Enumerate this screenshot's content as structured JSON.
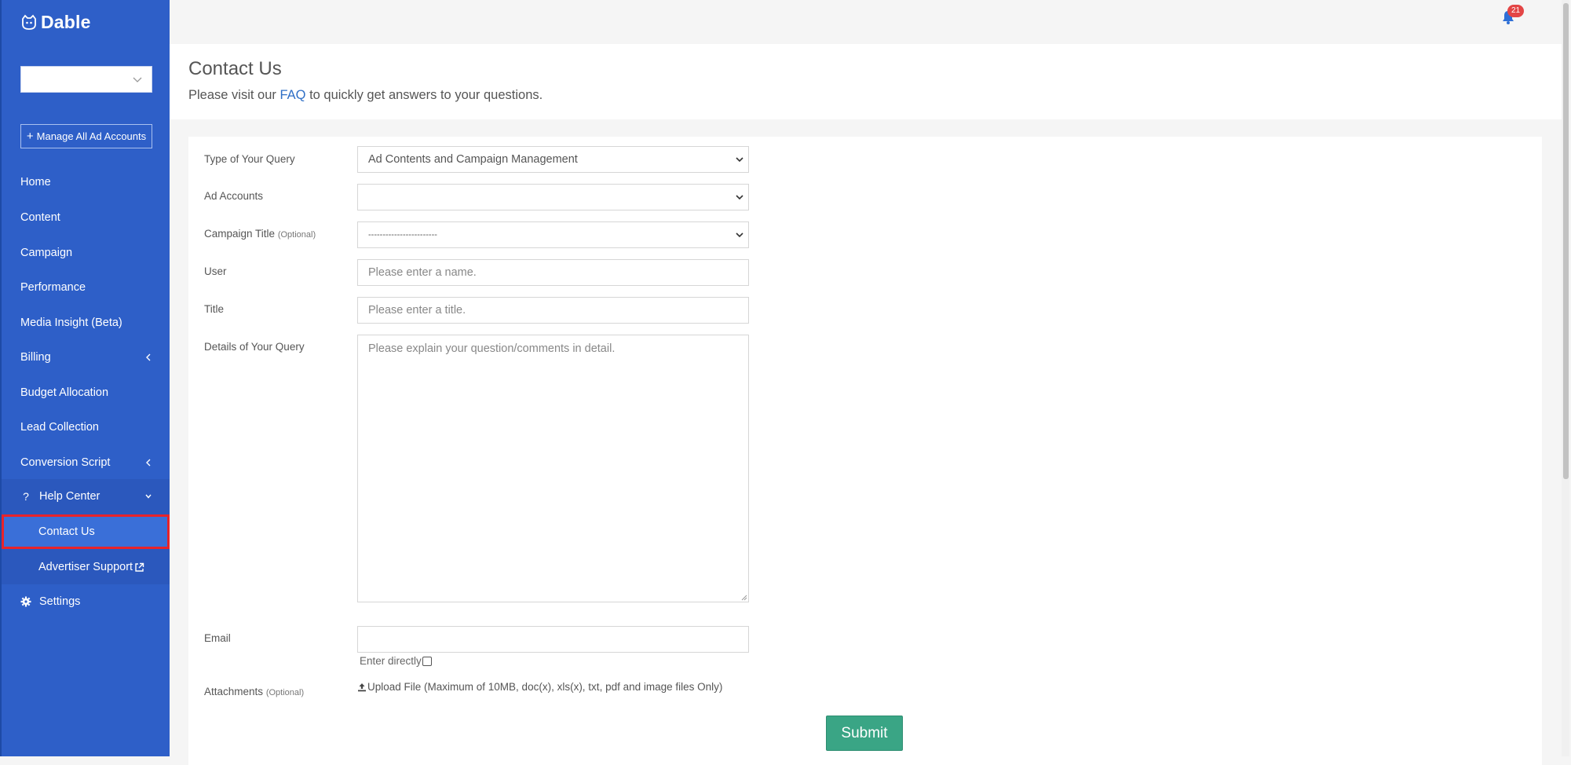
{
  "brand": {
    "name": "Dable"
  },
  "sidebar": {
    "account_select_value": "",
    "manage_button": {
      "icon": "plus",
      "label": "Manage All Ad Accounts"
    },
    "items": [
      {
        "label": "Home"
      },
      {
        "label": "Content"
      },
      {
        "label": "Campaign"
      },
      {
        "label": "Performance"
      },
      {
        "label": "Media Insight (Beta)"
      },
      {
        "label": "Billing",
        "has_submenu": true
      },
      {
        "label": "Budget Allocation"
      },
      {
        "label": "Lead Collection"
      },
      {
        "label": "Conversion Script",
        "has_submenu": true
      },
      {
        "label": "Help Center",
        "icon": "?",
        "expanded": true,
        "children": [
          {
            "label": "Contact Us",
            "active": true
          },
          {
            "label": "Advertiser Support",
            "external": true
          }
        ]
      },
      {
        "label": "Settings",
        "icon": "gear-icon"
      }
    ]
  },
  "header": {
    "notification_count": "21"
  },
  "page": {
    "title": "Contact Us",
    "subtitle_prefix": "Please visit our ",
    "subtitle_link": "FAQ",
    "subtitle_suffix": " to quickly get answers to your questions."
  },
  "form": {
    "query_type": {
      "label": "Type of Your Query",
      "value": "Ad Contents and Campaign Management"
    },
    "ad_accounts": {
      "label": "Ad Accounts",
      "value": ""
    },
    "campaign_title": {
      "label": "Campaign Title",
      "optional": "(Optional)",
      "value": "------------------------"
    },
    "user": {
      "label": "User",
      "placeholder": "Please enter a name."
    },
    "title": {
      "label": "Title",
      "placeholder": "Please enter a title."
    },
    "details": {
      "label": "Details of Your Query",
      "placeholder": "Please explain your question/comments in detail."
    },
    "email": {
      "label": "Email",
      "value": "",
      "enter_directly_label": "Enter directly",
      "enter_directly_checked": false
    },
    "attachments": {
      "label": "Attachments",
      "optional": "(Optional)",
      "upload_text": "Upload File (Maximum of 10MB, doc(x), xls(x), txt, pdf and image files Only)"
    },
    "submit_label": "Submit"
  },
  "colors": {
    "sidebar": "#2e5fc8",
    "active_item": "#3a6fd8",
    "highlight": "#e8232a",
    "submit": "#3aa585",
    "link": "#2f6fc6"
  }
}
